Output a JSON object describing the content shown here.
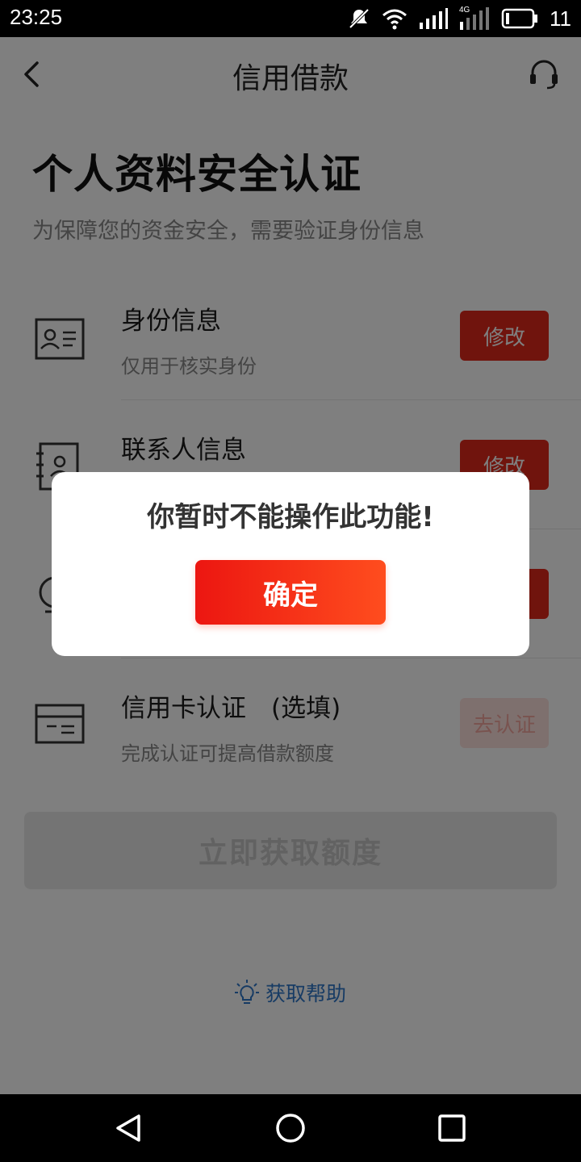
{
  "status_bar": {
    "time": "23:25",
    "battery": "11",
    "network_label": "4G",
    "icons": [
      "mute-icon",
      "wifi-icon",
      "signal-icon",
      "signal-4g-icon",
      "battery-icon"
    ]
  },
  "nav": {
    "title": "信用借款",
    "back_icon": "back-chevron-icon",
    "service_icon": "headset-icon"
  },
  "header": {
    "title": "个人资料安全认证",
    "subtitle": "为保障您的资金安全，需要验证身份信息"
  },
  "items": [
    {
      "title": "身份信息",
      "desc": "仅用于核实身份",
      "button": "修改",
      "icon": "id-card-icon"
    },
    {
      "title": "联系人信息",
      "desc": "",
      "button": "修改",
      "icon": "contact-book-icon"
    },
    {
      "title": "",
      "desc": "",
      "button": "",
      "icon": "hidden-icon"
    },
    {
      "title": "信用卡认证　(选填)",
      "desc": "完成认证可提高借款额度",
      "button": "去认证",
      "icon": "credit-card-icon"
    }
  ],
  "cta": {
    "label": "立即获取额度"
  },
  "help": {
    "label": "获取帮助",
    "icon": "lightbulb-icon"
  },
  "dialog": {
    "message": "你暂时不能操作此功能!",
    "confirm_label": "确定"
  },
  "colors": {
    "accent_red": "#e0281b",
    "gradient_start": "#ec1611",
    "gradient_end": "#ff4d1e",
    "link_blue": "#2f77c9"
  }
}
